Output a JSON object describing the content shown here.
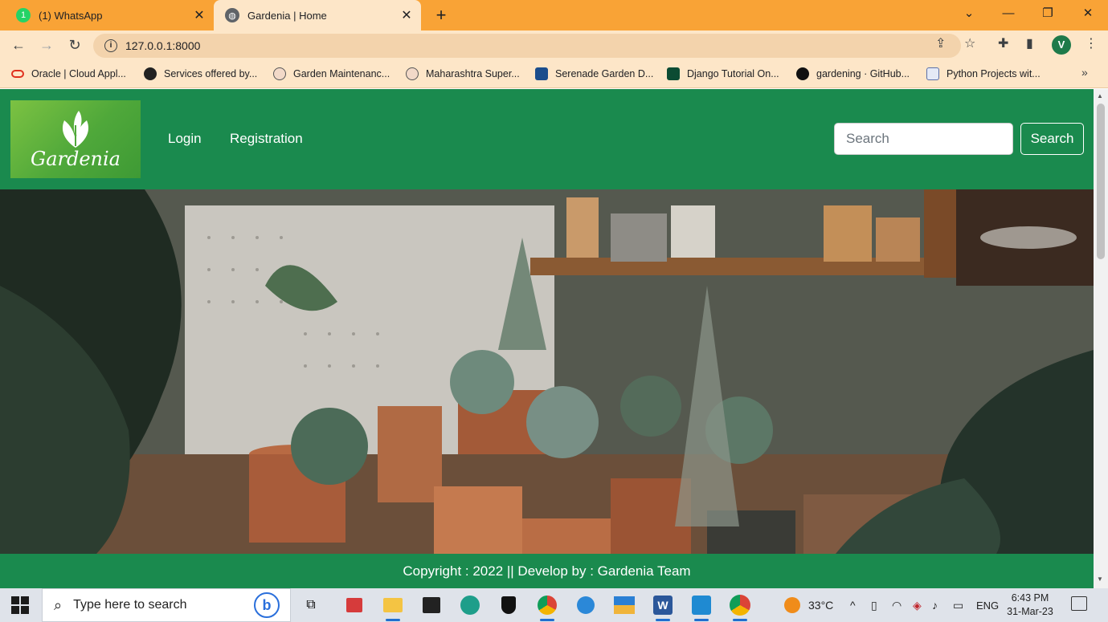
{
  "browser": {
    "tabs": [
      {
        "title": "(1) WhatsApp",
        "icon": "whatsapp-icon"
      },
      {
        "title": "Gardenia | Home",
        "icon": "globe-icon",
        "active": true
      }
    ],
    "url": "127.0.0.1:8000",
    "profile_initial": "V",
    "bookmarks": [
      {
        "label": "Oracle | Cloud Appl...",
        "icon": "oracle-icon"
      },
      {
        "label": "Services offered by...",
        "icon": "compass-icon"
      },
      {
        "label": "Garden Maintenanc...",
        "icon": "leaf-icon"
      },
      {
        "label": "Maharashtra Super...",
        "icon": "leaf-icon"
      },
      {
        "label": "Serenade Garden D...",
        "icon": "pn-icon"
      },
      {
        "label": "Django Tutorial On...",
        "icon": "django-icon"
      },
      {
        "label": "gardening · GitHub...",
        "icon": "github-icon"
      },
      {
        "label": "Python Projects wit...",
        "icon": "python-icon"
      }
    ]
  },
  "site": {
    "logo_text": "Gardenia",
    "nav": {
      "login": "Login",
      "registration": "Registration"
    },
    "search": {
      "placeholder": "Search",
      "button": "Search"
    },
    "footer": "Copyright : 2022 || Develop by : Gardenia Team"
  },
  "taskbar": {
    "search_placeholder": "Type here to search",
    "weather": "33°C",
    "language": "ENG",
    "time": "6:43 PM",
    "date": "31-Mar-23"
  },
  "colors": {
    "site_green": "#1a8a4e",
    "chrome_orange": "#f9a336",
    "chrome_toolbar": "#fde6c8"
  }
}
